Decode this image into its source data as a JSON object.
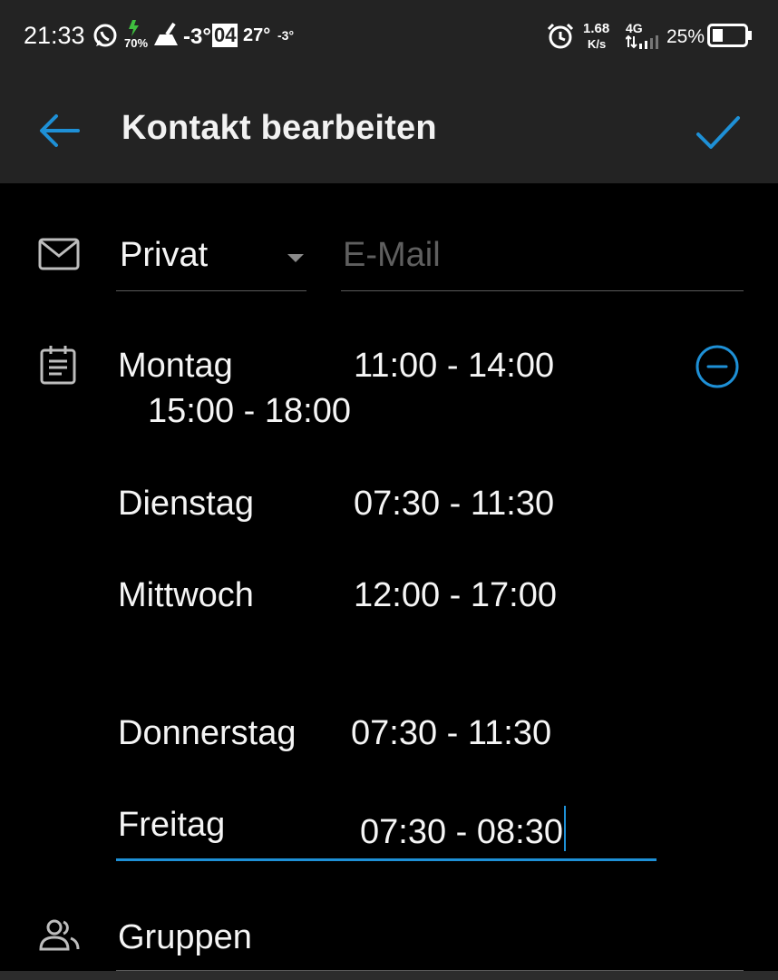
{
  "status_bar": {
    "time": "21:33",
    "battery_small": "70%",
    "temp1": "-3°",
    "date_box": "04",
    "temp2": "27°",
    "temp3": "-3°",
    "speed_value": "1.68",
    "speed_unit": "K/s",
    "network": "4G",
    "battery_percent": "25%"
  },
  "app_bar": {
    "title": "Kontakt bearbeiten"
  },
  "email": {
    "type_value": "Privat",
    "placeholder": "E-Mail"
  },
  "schedule": [
    {
      "day": "Montag",
      "time": "11:00 - 14:00"
    },
    {
      "extra": "15:00 - 18:00"
    },
    {
      "day": "Dienstag",
      "time": "07:30 - 11:30"
    },
    {
      "day": "Mittwoch",
      "time": "12:00 - 17:00"
    },
    {
      "day": "Donnerstag",
      "time": "07:30 - 11:30"
    },
    {
      "day": "Freitag",
      "time": "07:30 - 08:30"
    }
  ],
  "groups": {
    "label": "Gruppen"
  },
  "colors": {
    "accent": "#1e90d6",
    "bar": "#232323",
    "background": "#000000"
  }
}
